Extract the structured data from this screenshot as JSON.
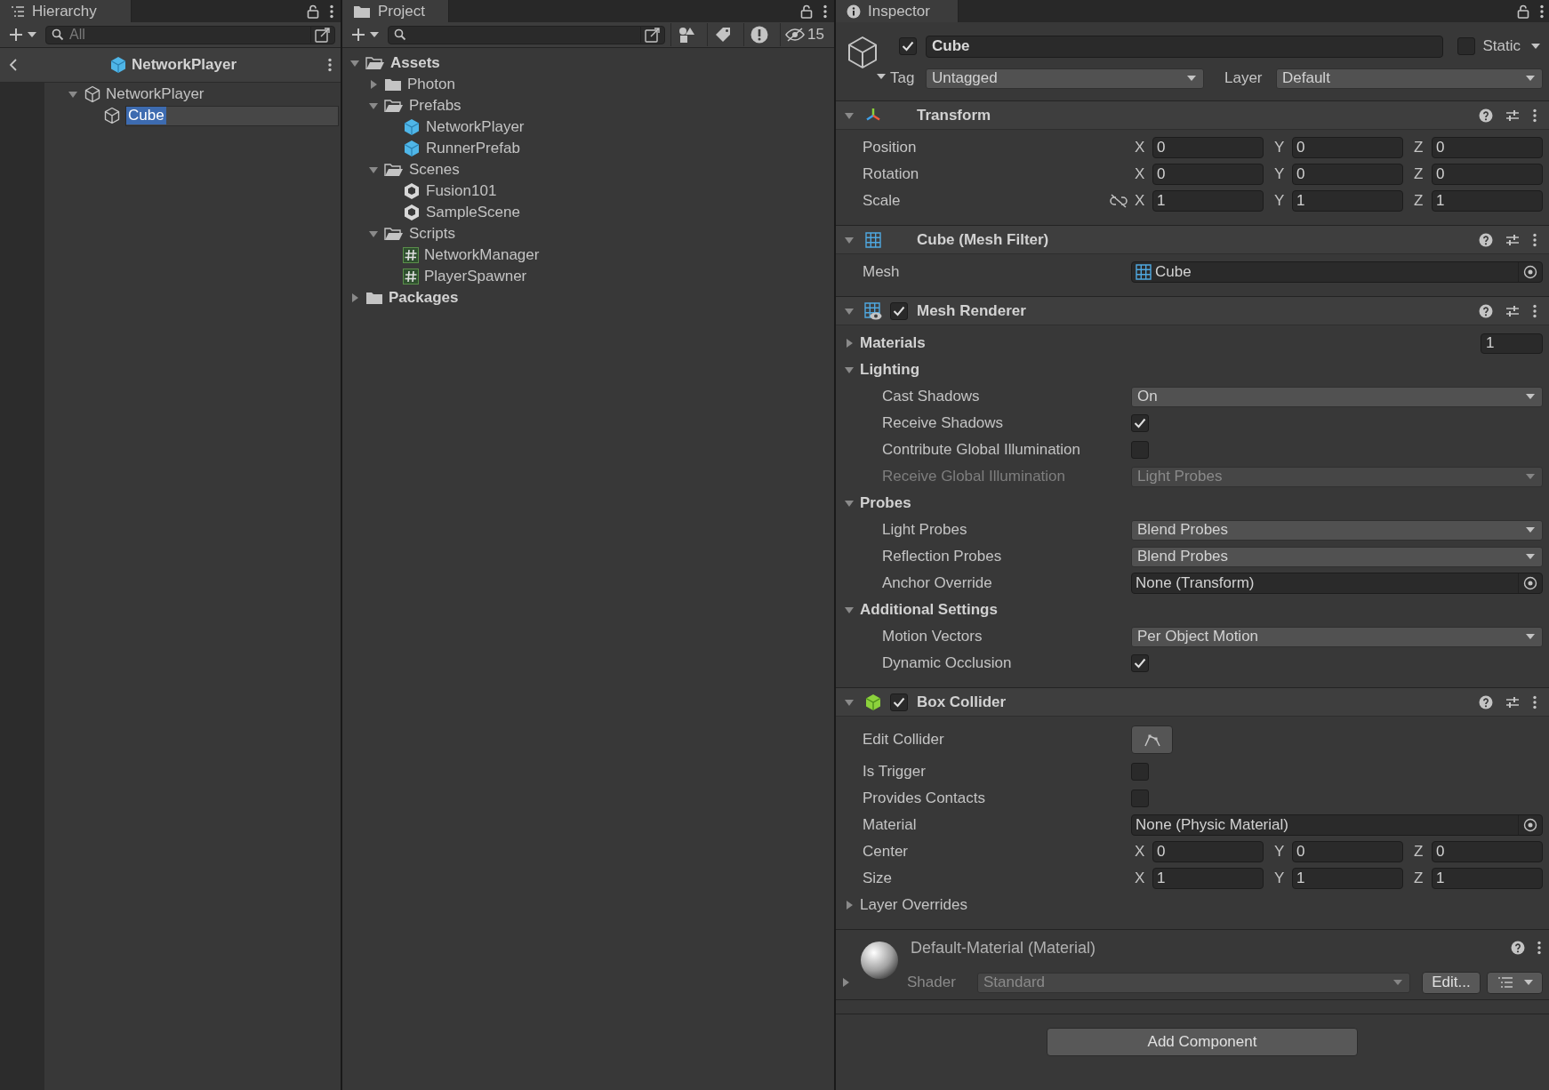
{
  "hierarchy": {
    "tab": "Hierarchy",
    "search": {
      "placeholder": "All"
    },
    "breadcrumb": "NetworkPlayer",
    "items": [
      {
        "name": "NetworkPlayer",
        "expanded": true,
        "selected": false,
        "children": [
          {
            "name": "Cube",
            "selected": true
          }
        ]
      }
    ]
  },
  "project": {
    "tab": "Project",
    "hidden_count": "15",
    "tree": [
      {
        "name": "Assets",
        "kind": "folder",
        "expanded": true,
        "children": [
          {
            "name": "Photon",
            "kind": "folder",
            "expanded": false
          },
          {
            "name": "Prefabs",
            "kind": "folder",
            "expanded": true,
            "children": [
              {
                "name": "NetworkPlayer",
                "kind": "prefab"
              },
              {
                "name": "RunnerPrefab",
                "kind": "prefab"
              }
            ]
          },
          {
            "name": "Scenes",
            "kind": "folder",
            "expanded": true,
            "children": [
              {
                "name": "Fusion101",
                "kind": "scene"
              },
              {
                "name": "SampleScene",
                "kind": "scene"
              }
            ]
          },
          {
            "name": "Scripts",
            "kind": "folder",
            "expanded": true,
            "children": [
              {
                "name": "NetworkManager",
                "kind": "script"
              },
              {
                "name": "PlayerSpawner",
                "kind": "script"
              }
            ]
          }
        ]
      },
      {
        "name": "Packages",
        "kind": "folder",
        "expanded": false
      }
    ]
  },
  "inspector": {
    "tab": "Inspector",
    "object": {
      "active": true,
      "name": "Cube",
      "static": false,
      "static_label": "Static",
      "tag_label": "Tag",
      "tag": "Untagged",
      "layer_label": "Layer",
      "layer": "Default"
    },
    "components": [
      {
        "title": "Transform",
        "kind": "transform",
        "expanded": true,
        "rows": [
          {
            "kind": "vector",
            "label": "Position",
            "values": [
              {
                "axis": "X",
                "value": "0"
              },
              {
                "axis": "Y",
                "value": "0"
              },
              {
                "axis": "Z",
                "value": "0"
              }
            ]
          },
          {
            "kind": "vector",
            "label": "Rotation",
            "values": [
              {
                "axis": "X",
                "value": "0"
              },
              {
                "axis": "Y",
                "value": "0"
              },
              {
                "axis": "Z",
                "value": "0"
              }
            ]
          },
          {
            "kind": "vector",
            "label": "Scale",
            "linked": false,
            "values": [
              {
                "axis": "X",
                "value": "1"
              },
              {
                "axis": "Y",
                "value": "1"
              },
              {
                "axis": "Z",
                "value": "1"
              }
            ]
          }
        ]
      },
      {
        "title": "Cube (Mesh Filter)",
        "kind": "mesh-filter",
        "expanded": true,
        "rows": [
          {
            "kind": "mesh-object",
            "label": "Mesh",
            "value": "Cube"
          }
        ]
      },
      {
        "title": "Mesh Renderer",
        "kind": "mesh-renderer",
        "enabled": true,
        "expanded": true,
        "rows": [
          {
            "kind": "foldout",
            "label": "Materials",
            "bold": true,
            "expanded": false,
            "count": "1"
          },
          {
            "kind": "foldout",
            "label": "Lighting",
            "bold": true,
            "expanded": true,
            "children": [
              {
                "kind": "dropdown",
                "label": "Cast Shadows",
                "value": "On",
                "disabled": false
              },
              {
                "kind": "checkbox",
                "label": "Receive Shadows",
                "checked": true
              },
              {
                "kind": "checkbox",
                "label": "Contribute Global Illumination",
                "checked": false
              },
              {
                "kind": "dropdown",
                "label": "Receive Global Illumination",
                "value": "Light Probes",
                "disabled": true
              }
            ]
          },
          {
            "kind": "foldout",
            "label": "Probes",
            "bold": true,
            "expanded": true,
            "children": [
              {
                "kind": "dropdown",
                "label": "Light Probes",
                "value": "Blend Probes",
                "disabled": false
              },
              {
                "kind": "dropdown",
                "label": "Reflection Probes",
                "value": "Blend Probes",
                "disabled": false
              },
              {
                "kind": "object",
                "label": "Anchor Override",
                "value": "None (Transform)"
              }
            ]
          },
          {
            "kind": "foldout",
            "label": "Additional Settings",
            "bold": true,
            "expanded": true,
            "children": [
              {
                "kind": "dropdown",
                "label": "Motion Vectors",
                "value": "Per Object Motion",
                "disabled": false
              },
              {
                "kind": "checkbox",
                "label": "Dynamic Occlusion",
                "checked": true
              }
            ]
          }
        ]
      },
      {
        "title": "Box Collider",
        "kind": "box-collider",
        "enabled": true,
        "expanded": true,
        "rows": [
          {
            "kind": "edit-button",
            "label": "Edit Collider"
          },
          {
            "kind": "checkbox",
            "label": "Is Trigger",
            "checked": false
          },
          {
            "kind": "checkbox",
            "label": "Provides Contacts",
            "checked": false
          },
          {
            "kind": "object",
            "label": "Material",
            "value": "None (Physic Material)"
          },
          {
            "kind": "vector",
            "label": "Center",
            "values": [
              {
                "axis": "X",
                "value": "0"
              },
              {
                "axis": "Y",
                "value": "0"
              },
              {
                "axis": "Z",
                "value": "0"
              }
            ]
          },
          {
            "kind": "vector",
            "label": "Size",
            "values": [
              {
                "axis": "X",
                "value": "1"
              },
              {
                "axis": "Y",
                "value": "1"
              },
              {
                "axis": "Z",
                "value": "1"
              }
            ]
          },
          {
            "kind": "foldout",
            "label": "Layer Overrides",
            "bold": false,
            "expanded": false
          }
        ]
      }
    ],
    "material": {
      "name": "Default-Material (Material)",
      "expanded": false,
      "shader_label": "Shader",
      "shader": "Standard",
      "edit_button": "Edit..."
    },
    "add_component": "Add Component"
  }
}
